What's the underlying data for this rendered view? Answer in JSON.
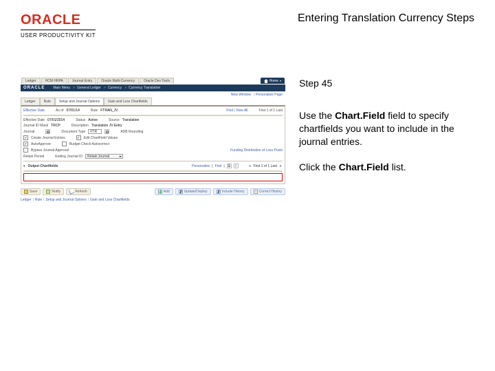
{
  "header": {
    "brand": "ORACLE",
    "brand_sub": "USER PRODUCTIVITY KIT",
    "title": "Entering Translation Currency Steps"
  },
  "instruction": {
    "step": "Step 45",
    "para1_a": "Use the ",
    "para1_b": "Chart.Field",
    "para1_c": " field to specify chartfields you want to include in the journal entries.",
    "para2_a": "Click the ",
    "para2_b": "Chart.Field",
    "para2_c": " list."
  },
  "mini": {
    "top_tabs": [
      "Ledger",
      "HCM HRPA",
      "Journal Entry",
      "Oracle Multi-Currency",
      "Oracle Dev Tools"
    ],
    "home": "Home",
    "oracle": "ORACLE",
    "crumbs": [
      "Main Menu",
      "General Ledger",
      "Currency",
      "Currency Translation"
    ],
    "sublinks": [
      "New Window",
      "Personalize Page"
    ],
    "navtabs": [
      "Ledger",
      "Rule",
      "Setup and Journal Options",
      "Gain and Loss Chartfields"
    ],
    "row_period": {
      "lbl": "Effective Date",
      "val_lbl": "As of",
      "val": "07/01/14",
      "rule_lbl": "Rule",
      "rule_val": "FTRAN_JV",
      "fcj": "Find | View All",
      "pg": "First 1 of 1 Last"
    },
    "row_a": {
      "a_lbl": "Effective Date",
      "a_val": "07/01/2014",
      "b_lbl": "Status",
      "b_val": "Active",
      "c_lbl": "Source",
      "c_val": "Translation"
    },
    "row_b": {
      "a_lbl": "Journal ID Mask",
      "a_val": "TRCP",
      "b_lbl": "Description",
      "b_val": "Translation JV Entry"
    },
    "row_c": {
      "a_lbl": "Journal",
      "b_lbl": "Document Type",
      "b_input": "FTR",
      "c_lbl": "ADB Rounding"
    },
    "chk1": {
      "lbl": "Create Journal Entries",
      "chk2_lbl": "Edit ChartField Values"
    },
    "chk2": {
      "lbl": "AutoApprove",
      "chk2_lbl": "Budget Check Autocorrect"
    },
    "chk3": {
      "lbl": "Bypass Journal Approval",
      "link": "Funding Distribution of Loss Pools"
    },
    "row_f": {
      "lbl": "Retain Period",
      "sel": "Ending Journal ID",
      "sel2_val": "Retain Journal"
    },
    "section": "Output Chartfields",
    "pager": {
      "personalize": "Personalize",
      "find": "Find",
      "pg": "First 1 of 1 Last"
    },
    "footer_btns": [
      "Save",
      "Notify",
      "Refresh",
      "Add",
      "Update/Display",
      "Include History",
      "Correct History"
    ],
    "footer_tabs": [
      "Ledger",
      "Rule",
      "Setup and Journal Options",
      "Gain and Loss Chartfields"
    ]
  }
}
